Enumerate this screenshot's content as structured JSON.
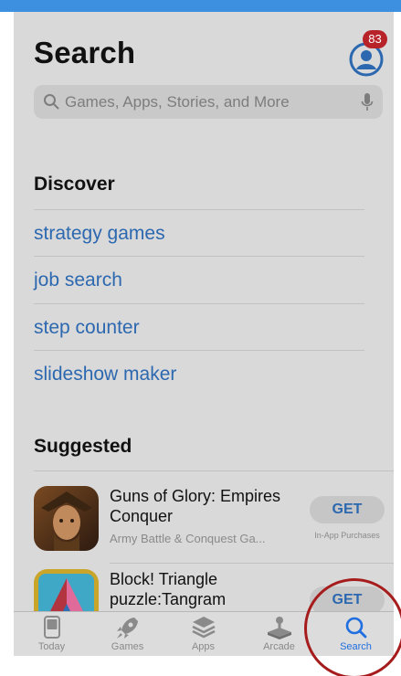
{
  "header": {
    "title": "Search",
    "notification_count": "83"
  },
  "search": {
    "placeholder": "Games, Apps, Stories, and More"
  },
  "discover": {
    "title": "Discover",
    "items": [
      {
        "label": "strategy games"
      },
      {
        "label": "job search"
      },
      {
        "label": "step counter"
      },
      {
        "label": "slideshow maker"
      }
    ]
  },
  "suggested": {
    "title": "Suggested",
    "apps": [
      {
        "name": "Guns of Glory: Empires Conquer",
        "subtitle": "Army Battle & Conquest Ga...",
        "button": "GET",
        "note": "In-App Purchases"
      },
      {
        "name": "Block! Triangle puzzle:Tangram",
        "button": "GET"
      }
    ]
  },
  "tabbar": {
    "tabs": [
      {
        "label": "Today",
        "icon": "today-icon",
        "active": false
      },
      {
        "label": "Games",
        "icon": "rocket-icon",
        "active": false
      },
      {
        "label": "Apps",
        "icon": "layers-icon",
        "active": false
      },
      {
        "label": "Arcade",
        "icon": "joystick-icon",
        "active": false
      },
      {
        "label": "Search",
        "icon": "search-icon",
        "active": true
      }
    ]
  },
  "colors": {
    "accent": "#2c68b0",
    "active_tab": "#1f6fe0",
    "badge": "#b8232a",
    "highlight_circle": "#a61c1c",
    "top_bar": "#3d8fe0"
  }
}
